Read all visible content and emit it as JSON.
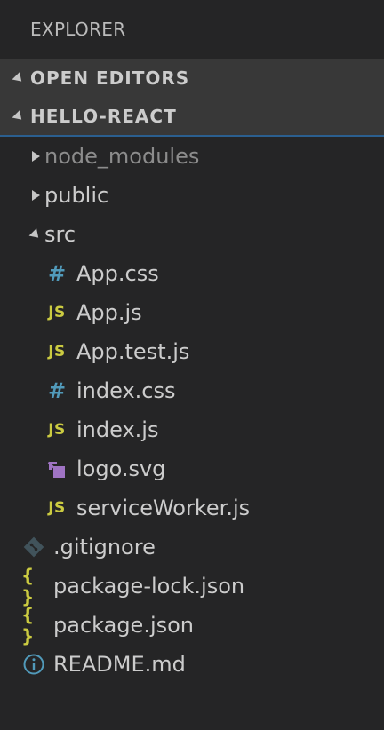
{
  "explorer": {
    "title": "EXPLORER"
  },
  "sections": {
    "open_editors": "OPEN EDITORS",
    "project": "HELLO-REACT"
  },
  "tree": {
    "node_modules": "node_modules",
    "public": "public",
    "src": "src",
    "src_files": [
      {
        "name": "App.css",
        "icon": "css-icon"
      },
      {
        "name": "App.js",
        "icon": "js-icon"
      },
      {
        "name": "App.test.js",
        "icon": "js-icon"
      },
      {
        "name": "index.css",
        "icon": "css-icon"
      },
      {
        "name": "index.js",
        "icon": "js-icon"
      },
      {
        "name": "logo.svg",
        "icon": "svg-icon"
      },
      {
        "name": "serviceWorker.js",
        "icon": "js-icon"
      }
    ],
    "root_files": [
      {
        "name": ".gitignore",
        "icon": "git-icon"
      },
      {
        "name": "package-lock.json",
        "icon": "json-icon"
      },
      {
        "name": "package.json",
        "icon": "json-icon"
      },
      {
        "name": "README.md",
        "icon": "info-icon"
      }
    ]
  },
  "icon_glyphs": {
    "css": "#",
    "js": "JS",
    "json": "{ }"
  },
  "colors": {
    "background": "#252526",
    "section_header_bg": "#383838",
    "focus_border": "#2b5f8f",
    "text": "#cccccc",
    "dim_text": "#8c8c8c",
    "css_icon": "#519aba",
    "js_icon": "#cbcb41",
    "json_icon": "#cbcb41",
    "svg_icon": "#a074c4",
    "git_icon": "#41535b",
    "info_icon": "#519aba"
  }
}
